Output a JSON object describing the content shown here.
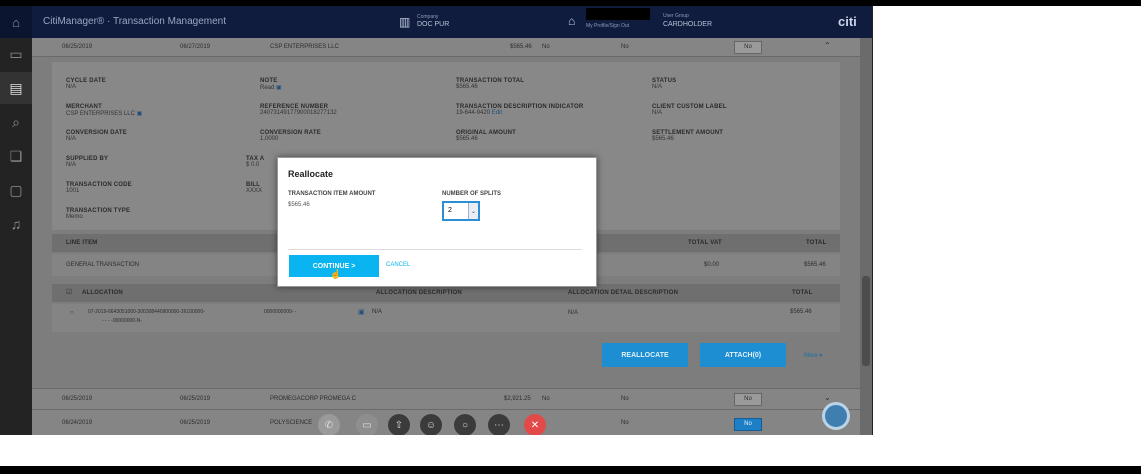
{
  "header": {
    "app_title": "CitiManager® · Transaction Management",
    "company_label": "Company",
    "company_value": "DOC PUR",
    "user_label": "My Profile/Sign Out",
    "user_group_label": "User Group",
    "user_group_value": "CARDHOLDER",
    "brand": "citi"
  },
  "rows_top": [
    {
      "date1": "06/25/2019",
      "date2": "06/27/2019",
      "merchant": "CSP ENTERPRISES LLC",
      "amount": "$565.46",
      "flag": "No",
      "flag2": "No",
      "toggle": "No"
    }
  ],
  "detail": {
    "cycle_date_label": "CYCLE DATE",
    "cycle_date": "N/A",
    "note_label": "NOTE",
    "note": "Read",
    "transaction_total_label": "TRANSACTION TOTAL",
    "transaction_total": "$565.46",
    "status_label": "STATUS",
    "status": "N/A",
    "merchant_label": "MERCHANT",
    "merchant": "CSP ENTERPRISES LLC",
    "reference_label": "REFERENCE NUMBER",
    "reference": "24073149177900018277132",
    "tdi_label": "TRANSACTION DESCRIPTION INDICATOR",
    "tdi": "19-644-9420",
    "tdi_edit": "Edit",
    "client_custom_label": "CLIENT CUSTOM LABEL",
    "client_custom": "N/A",
    "conversion_date_label": "CONVERSION DATE",
    "conversion_date": "N/A",
    "conversion_rate_label": "CONVERSION RATE",
    "conversion_rate": "1.0000",
    "original_amount_label": "ORIGINAL AMOUNT",
    "original_amount": "$565.46",
    "settlement_amount_label": "SETTLEMENT AMOUNT",
    "settlement_amount": "$565.46",
    "supplied_by_label": "SUPPLIED BY",
    "supplied_by": "N/A",
    "tax_label": "TAX A",
    "tax": "$ 0.0",
    "transaction_code_label": "TRANSACTION CODE",
    "transaction_code": "1001",
    "bill_label": "BILL",
    "bill": "XXXX",
    "transaction_type_label": "TRANSACTION TYPE",
    "transaction_type": "Memo"
  },
  "line_items": {
    "header_line_item": "LINE ITEM",
    "header_total_vat": "TOTAL VAT",
    "header_total": "TOTAL",
    "row_name": "GENERAL TRANSACTION",
    "row_vat": "$0.00",
    "row_total": "$565.46"
  },
  "allocation": {
    "header_allocation": "ALLOCATION",
    "header_alloc_desc": "ALLOCATION DESCRIPTION",
    "header_alloc_detail": "ALLOCATION DETAIL DESCRIPTION",
    "header_total": "TOTAL",
    "row_code1": "07-2019-6643051000-300308440900000-26100000-",
    "row_code2": "-   -   -   -00000000-N-",
    "row_code3": "0000000000-   -",
    "row_desc": "N/A",
    "row_detail": "N/A",
    "row_total": "$565.46"
  },
  "actions": {
    "reallocate": "REALLOCATE",
    "attach": "ATTACH(0)",
    "more": "More ▾"
  },
  "rows_bottom": [
    {
      "date1": "06/25/2019",
      "date2": "06/25/2019",
      "merchant": "PROMEGACORP PROMEGA C",
      "amount": "$2,921.25",
      "flag": "No",
      "flag2": "No",
      "toggle": "No"
    },
    {
      "date1": "06/24/2019",
      "date2": "06/25/2019",
      "merchant": "POLYSCIENCE",
      "amount": "",
      "flag": "",
      "flag2": "No",
      "toggle": "No"
    }
  ],
  "modal": {
    "title": "Reallocate",
    "amount_label": "TRANSACTION ITEM AMOUNT",
    "amount": "$565.46",
    "splits_label": "NUMBER OF SPLITS",
    "splits_value": "2",
    "continue": "CONTINUE >",
    "cancel": "CANCEL"
  },
  "colors": {
    "header": "#0f1c3e",
    "accent": "#0ab4f0",
    "button": "#1d8ed1"
  }
}
